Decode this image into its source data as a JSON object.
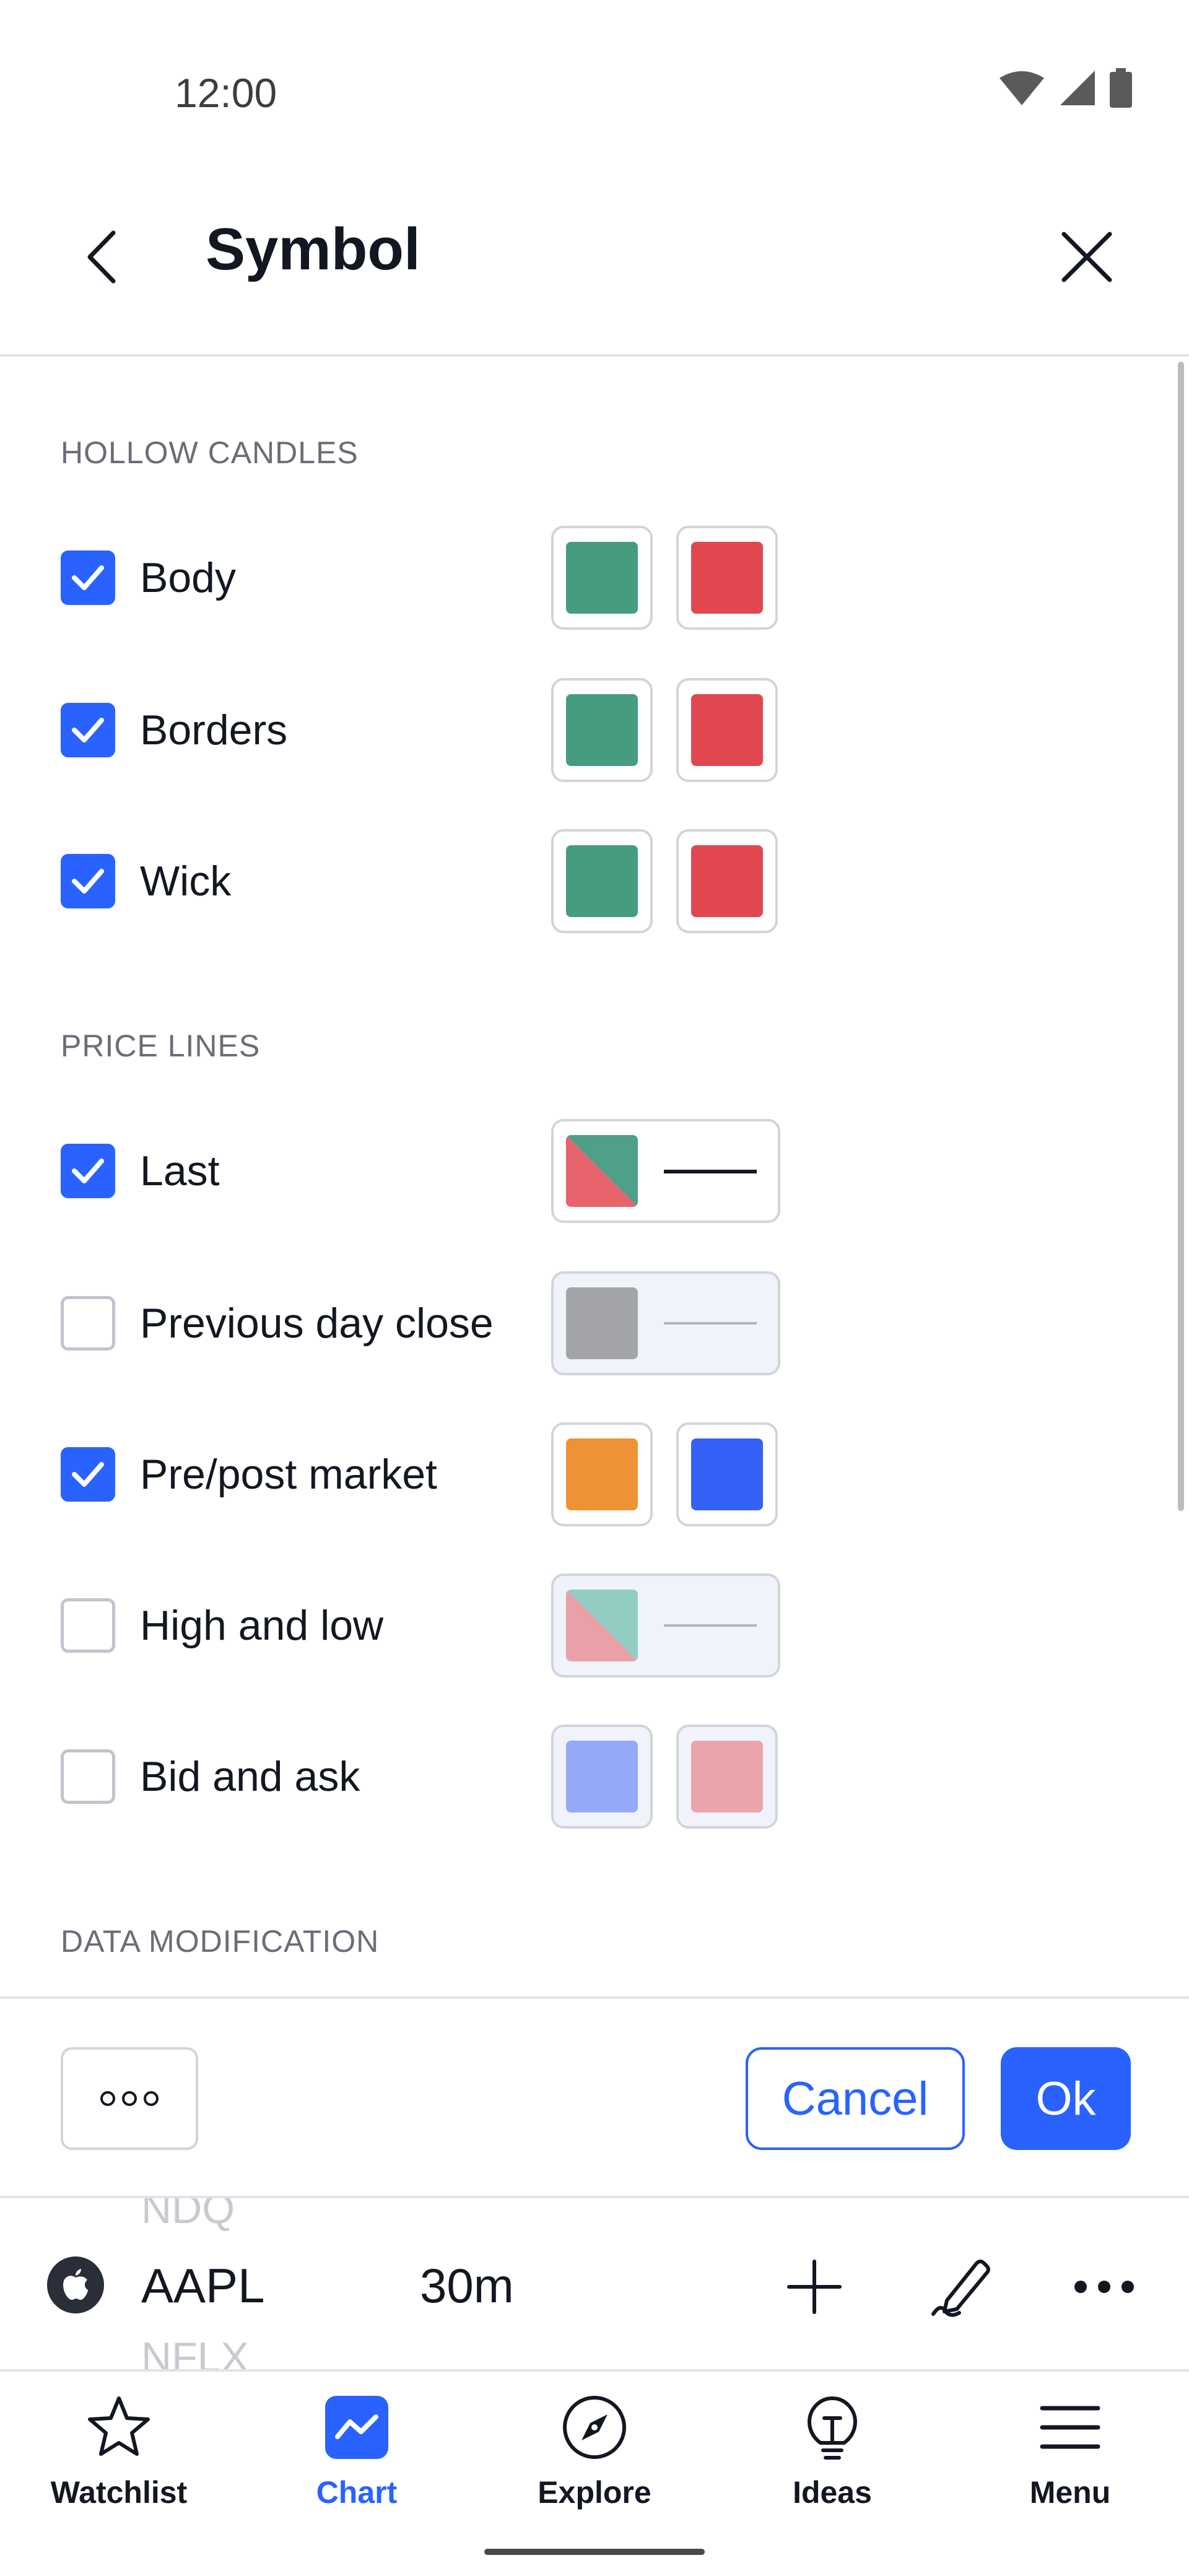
{
  "status_bar": {
    "time": "12:00"
  },
  "header": {
    "title": "Symbol"
  },
  "sections": {
    "hollow_candles": {
      "title": "HOLLOW CANDLES",
      "rows": [
        {
          "label": "Body",
          "checked": true,
          "colors": [
            "#459c80",
            "#e1474f"
          ]
        },
        {
          "label": "Borders",
          "checked": true,
          "colors": [
            "#459c80",
            "#e1474f"
          ]
        },
        {
          "label": "Wick",
          "checked": true,
          "colors": [
            "#459c80",
            "#e1474f"
          ]
        }
      ]
    },
    "price_lines": {
      "title": "PRICE LINES",
      "rows": [
        {
          "label": "Last",
          "checked": true,
          "style": "split-line",
          "colors": [
            "#e8636b",
            "#4ea08a"
          ]
        },
        {
          "label": "Previous day close",
          "checked": false,
          "style": "solid-line",
          "colors": [
            "#a3a4a8"
          ]
        },
        {
          "label": "Pre/post market",
          "checked": true,
          "colors": [
            "#ef9235",
            "#3461f6"
          ]
        },
        {
          "label": "High and low",
          "checked": false,
          "style": "split-line",
          "colors": [
            "#eaa0a9",
            "#93ccc3"
          ]
        },
        {
          "label": "Bid and ask",
          "checked": false,
          "colors": [
            "#95a9f8",
            "#eaa4ac"
          ]
        }
      ]
    },
    "data_modification": {
      "title": "DATA MODIFICATION"
    }
  },
  "footer": {
    "cancel_label": "Cancel",
    "ok_label": "Ok"
  },
  "toolbar": {
    "symbol": "AAPL",
    "interval": "30m",
    "ghost_above": "NDQ",
    "ghost_below": "NFLX"
  },
  "bottom_nav": {
    "items": [
      {
        "label": "Watchlist",
        "icon": "star-icon"
      },
      {
        "label": "Chart",
        "icon": "chart-icon",
        "active": true
      },
      {
        "label": "Explore",
        "icon": "compass-icon"
      },
      {
        "label": "Ideas",
        "icon": "lightbulb-icon"
      },
      {
        "label": "Menu",
        "icon": "menu-icon"
      }
    ]
  },
  "colors": {
    "accent": "#2962ff",
    "text": "#131722",
    "muted": "#6a6d78",
    "border": "#d1d4dc"
  }
}
